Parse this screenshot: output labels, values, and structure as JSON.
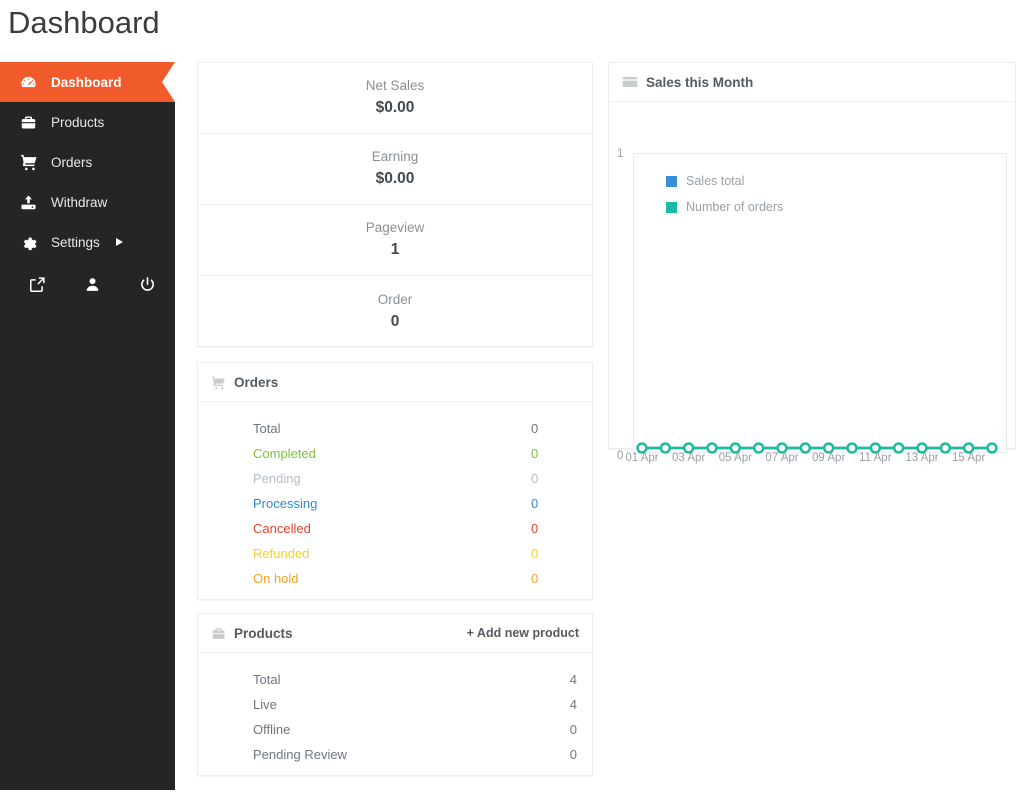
{
  "page": {
    "title": "Dashboard",
    "background": "#ffffff"
  },
  "colors": {
    "sidebar_bg": "#252525",
    "accent_orange": "#f15a2b",
    "card_border": "#eceeef",
    "text_muted": "#8a9095",
    "series_sales_total": "#3a8fd4",
    "series_number_of_orders": "#1abc9c"
  },
  "sidebar": {
    "items": [
      {
        "label": "Dashboard",
        "icon": "dashboard-gauge-icon",
        "active": true
      },
      {
        "label": "Products",
        "icon": "briefcase-icon",
        "active": false
      },
      {
        "label": "Orders",
        "icon": "shopping-cart-icon",
        "active": false
      },
      {
        "label": "Withdraw",
        "icon": "upload-box-icon",
        "active": false
      },
      {
        "label": "Settings",
        "icon": "gear-icon",
        "active": false,
        "has_submenu": true
      }
    ],
    "footer_icons": [
      {
        "name": "external-link-icon"
      },
      {
        "name": "user-icon"
      },
      {
        "name": "power-icon"
      }
    ]
  },
  "stats": {
    "rows": [
      {
        "label": "Net Sales",
        "value": "$0.00"
      },
      {
        "label": "Earning",
        "value": "$0.00"
      },
      {
        "label": "Pageview",
        "value": "1"
      },
      {
        "label": "Order",
        "value": "0"
      }
    ]
  },
  "orders_card": {
    "title": "Orders",
    "icon": "shopping-cart-icon",
    "rows": [
      {
        "label": "Total",
        "value": "0",
        "color": "#6f767c"
      },
      {
        "label": "Completed",
        "value": "0",
        "color": "#7ec13d"
      },
      {
        "label": "Pending",
        "value": "0",
        "color": "#b7bdc2"
      },
      {
        "label": "Processing",
        "value": "0",
        "color": "#2e8bc9"
      },
      {
        "label": "Cancelled",
        "value": "0",
        "color": "#e8412b"
      },
      {
        "label": "Refunded",
        "value": "0",
        "color": "#f3d22b"
      },
      {
        "label": "On hold",
        "value": "0",
        "color": "#f5a31e"
      }
    ]
  },
  "products_card": {
    "title": "Products",
    "icon": "briefcase-icon",
    "add_action": "+ Add new product",
    "rows": [
      {
        "label": "Total",
        "value": "4"
      },
      {
        "label": "Live",
        "value": "4"
      },
      {
        "label": "Offline",
        "value": "0"
      },
      {
        "label": "Pending Review",
        "value": "0"
      }
    ]
  },
  "chart_card": {
    "title": "Sales this Month",
    "icon": "credit-card-icon"
  },
  "chart_data": {
    "type": "line",
    "title": "Sales this Month",
    "xlabel": "",
    "ylabel": "",
    "x": [
      "01 Apr",
      "02 Apr",
      "03 Apr",
      "04 Apr",
      "05 Apr",
      "06 Apr",
      "07 Apr",
      "08 Apr",
      "09 Apr",
      "10 Apr",
      "11 Apr",
      "12 Apr",
      "13 Apr",
      "14 Apr",
      "15 Apr",
      "16 Apr"
    ],
    "tick_labels": [
      "01 Apr",
      "",
      "03 Apr",
      "",
      "05 Apr",
      "",
      "07 Apr",
      "",
      "09 Apr",
      "",
      "11 Apr",
      "",
      "13 Apr",
      "",
      "15 Apr",
      ""
    ],
    "ylim": [
      0,
      1
    ],
    "ytick_labels": [
      "0",
      "1"
    ],
    "grid": false,
    "legend_position": "top-left",
    "series": [
      {
        "name": "Sales total",
        "color": "#3a8fd4",
        "values": [
          0,
          0,
          0,
          0,
          0,
          0,
          0,
          0,
          0,
          0,
          0,
          0,
          0,
          0,
          0,
          0
        ]
      },
      {
        "name": "Number of orders",
        "color": "#1abc9c",
        "values": [
          0,
          0,
          0,
          0,
          0,
          0,
          0,
          0,
          0,
          0,
          0,
          0,
          0,
          0,
          0,
          0
        ]
      }
    ]
  }
}
